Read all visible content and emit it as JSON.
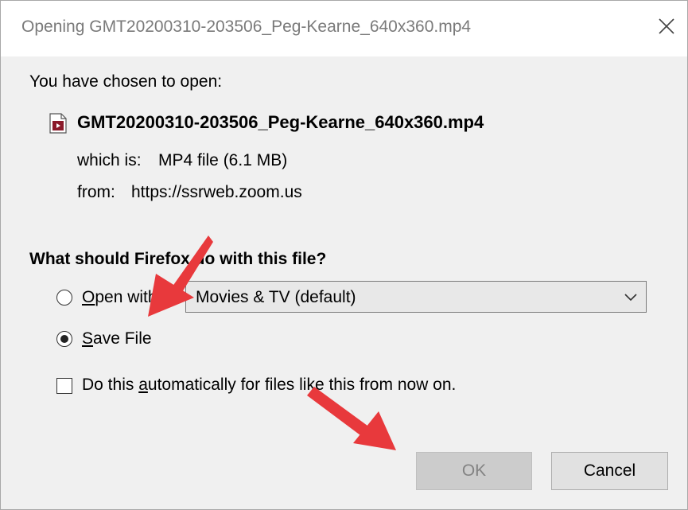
{
  "window": {
    "title": "Opening GMT20200310-203506_Peg-Kearne_640x360.mp4"
  },
  "intro": "You have chosen to open:",
  "file": {
    "name": "GMT20200310-203506_Peg-Kearne_640x360.mp4",
    "type_label": "which is:",
    "type_value": "MP4 file (6.1 MB)",
    "from_label": "from:",
    "from_value": "https://ssrweb.zoom.us",
    "icon": "video-file-icon"
  },
  "question": "What should Firefox do with this file?",
  "options": {
    "open_with": {
      "label_pre": "",
      "accel": "O",
      "label_post": "pen with",
      "selected": false,
      "app": "Movies & TV (default)"
    },
    "save_file": {
      "accel": "S",
      "label_post": "ave File",
      "selected": true
    }
  },
  "auto": {
    "label_pre": "Do this ",
    "accel": "a",
    "label_post": "utomatically for files like this from now on.",
    "checked": false
  },
  "buttons": {
    "ok": "OK",
    "cancel": "Cancel"
  },
  "colors": {
    "annotation_arrow": "#e8393c",
    "dialog_bg": "#f0f0f0",
    "title_text": "#7a7a7a"
  }
}
